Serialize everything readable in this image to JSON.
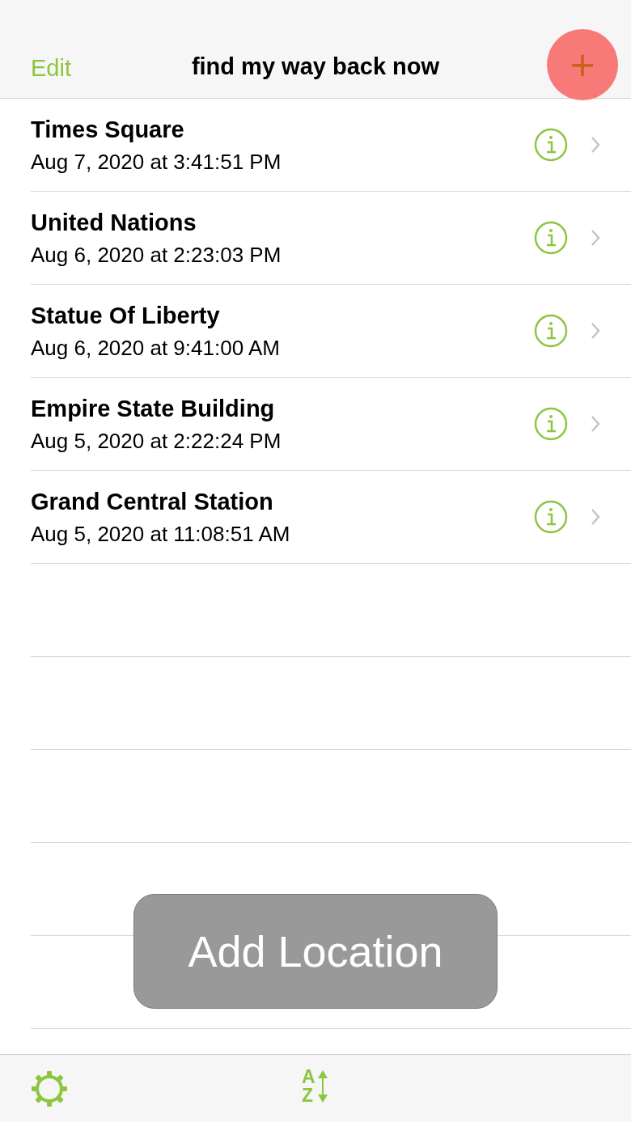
{
  "nav_bar": {
    "edit": "Edit",
    "title": "find my way back now",
    "add_button": {
      "label": "+",
      "pressed": true
    }
  },
  "locations": [
    {
      "name": "Times Square",
      "date": "Aug 7, 2020 at 3:41:51 PM"
    },
    {
      "name": "United Nations",
      "date": "Aug 6, 2020 at 2:23:03 PM"
    },
    {
      "name": "Statue Of Liberty",
      "date": "Aug 6, 2020 at 9:41:00 AM"
    },
    {
      "name": "Empire State Building",
      "date": "Aug 5, 2020 at 2:22:24 PM"
    },
    {
      "name": "Grand Central Station",
      "date": "Aug 5, 2020 at 11:08:51 AM"
    }
  ],
  "toast": "Add Location",
  "toolbar": {
    "sort_letters": [
      "A",
      "Z"
    ]
  }
}
